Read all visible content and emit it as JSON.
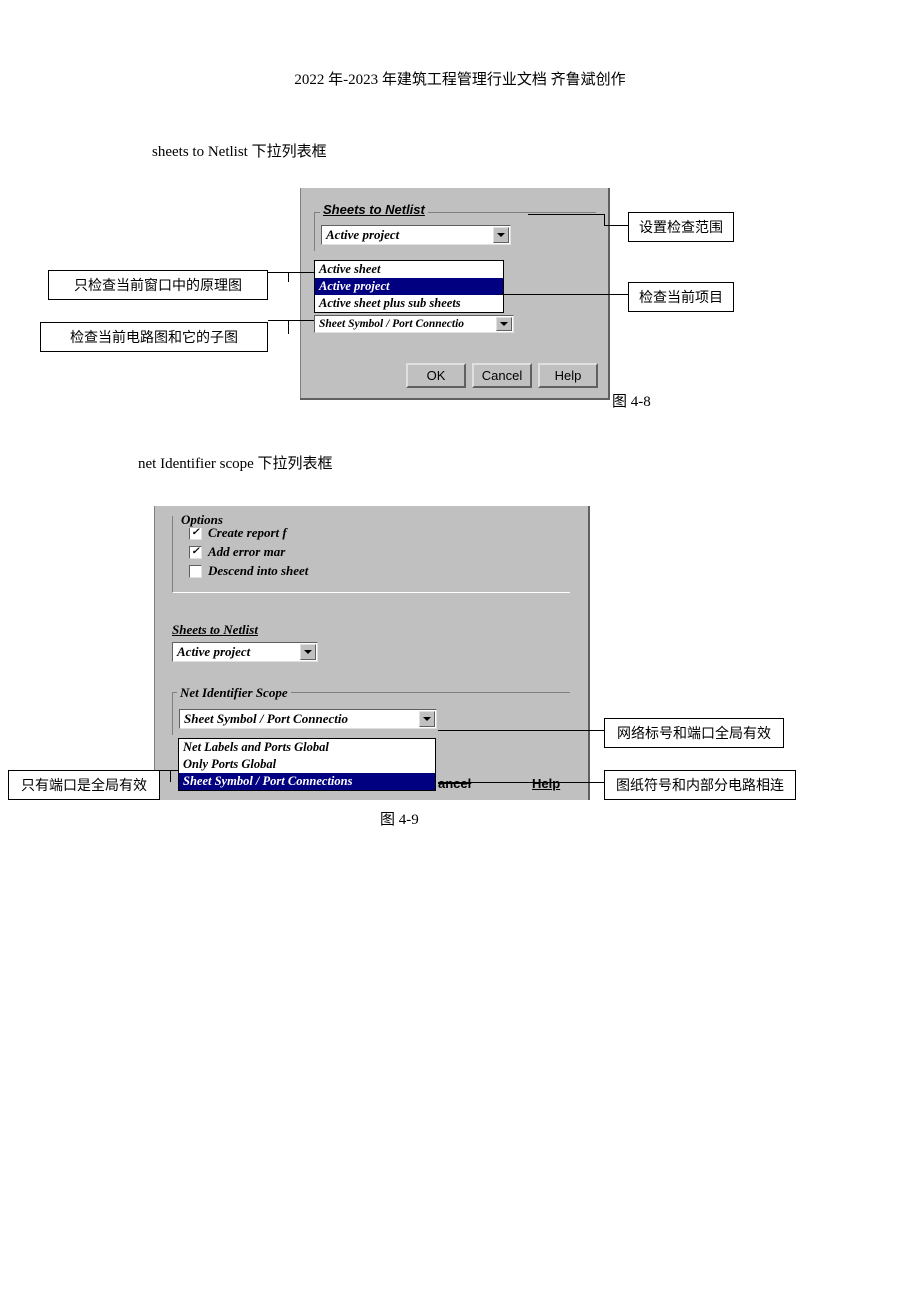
{
  "header": "2022 年-2023 年建筑工程管理行业文档 齐鲁斌创作",
  "section1": {
    "title": "sheets to Netlist  下拉列表框",
    "group_label": "Sheets to Netlist",
    "combo_value": "Active project",
    "dropdown": [
      "Active sheet",
      "Active project",
      "Active sheet plus sub sheets"
    ],
    "second_combo": "Sheet Symbol / Port Connectio",
    "buttons": {
      "ok": "OK",
      "cancel": "Cancel",
      "help": "Help"
    },
    "callouts": {
      "scope": "设置检查范围",
      "active_sheet": "只检查当前窗口中的原理图",
      "active_project": "检查当前项目",
      "sub_sheets": "检查当前电路图和它的子图"
    },
    "caption": "图 4-8"
  },
  "section2": {
    "title": "net Identifier scope  下拉列表框",
    "options_label": "Options",
    "options": [
      {
        "label": "Create report f",
        "checked": true
      },
      {
        "label": "Add error mar",
        "checked": true
      },
      {
        "label": "Descend into sheet",
        "checked": false
      }
    ],
    "sheets_label": "Sheets to Netlist",
    "sheets_value": "Active project",
    "net_label": "Net Identifier Scope",
    "net_value": "Sheet Symbol / Port Connectio",
    "net_dropdown": [
      "Net Labels and Ports Global",
      "Only Ports Global",
      "Sheet Symbol / Port Connections"
    ],
    "cancel_partial": "ancel",
    "help_partial": "Help",
    "callouts": {
      "global": "网络标号和端口全局有效",
      "ports_only": "只有端口是全局有效",
      "sheet_symbol": "图纸符号和内部分电路相连"
    },
    "caption": "图 4-9"
  }
}
